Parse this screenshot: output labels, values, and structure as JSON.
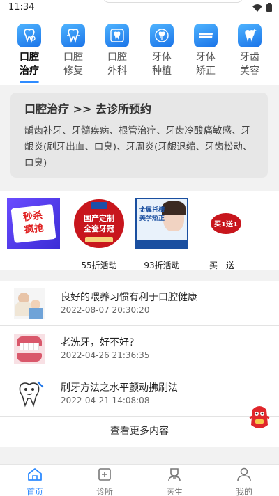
{
  "status_bar": {
    "time": "11:34"
  },
  "categories": [
    {
      "label": "口腔\n治疗",
      "icon": "tooth-search-icon",
      "active": true
    },
    {
      "label": "口腔\n修复",
      "icon": "tooth-repair-icon",
      "active": false
    },
    {
      "label": "口腔\n外科",
      "icon": "tooth-surgery-icon",
      "active": false
    },
    {
      "label": "牙体\n种植",
      "icon": "tooth-implant-icon",
      "active": false
    },
    {
      "label": "牙体\n矫正",
      "icon": "tooth-braces-icon",
      "active": false
    },
    {
      "label": "牙齿\n美容",
      "icon": "tooth-sparkle-icon",
      "active": false
    }
  ],
  "info_card": {
    "title": "口腔治疗 >> 去诊所预约",
    "description": "龋齿补牙、牙髓疾病、根管治疗、牙齿冷酸痛敏感、牙龈炎(刷牙出血、口臭)、牙周炎(牙龈退缩、牙齿松动、口臭)"
  },
  "promos": [
    {
      "image_text": "秒杀\n疯抢",
      "caption": ""
    },
    {
      "image_text": "国产定制\n全瓷牙冠",
      "caption": "55折活动"
    },
    {
      "image_text": "金属托槽\n美学矫正",
      "caption": "93折活动"
    },
    {
      "image_text": "买1送1",
      "caption": "买一送一"
    }
  ],
  "articles": [
    {
      "title": "良好的喂养习惯有利于口腔健康",
      "date": "2022-08-07 20:30:20"
    },
    {
      "title": "老洗牙，好不好?",
      "date": "2022-04-26 21:36:35"
    },
    {
      "title": "刷牙方法之水平颤动拂刷法",
      "date": "2022-04-21 14:08:08"
    }
  ],
  "more_label": "查看更多内容",
  "tabs": [
    {
      "label": "首页",
      "icon": "home-icon",
      "active": true
    },
    {
      "label": "诊所",
      "icon": "clinic-icon",
      "active": false
    },
    {
      "label": "医生",
      "icon": "doctor-icon",
      "active": false
    },
    {
      "label": "我的",
      "icon": "profile-icon",
      "active": false
    }
  ],
  "colors": {
    "accent": "#2e8bff",
    "icon_gradient_start": "#4fb4ff",
    "icon_gradient_end": "#1a73e8",
    "promo_red": "#c8161d"
  }
}
